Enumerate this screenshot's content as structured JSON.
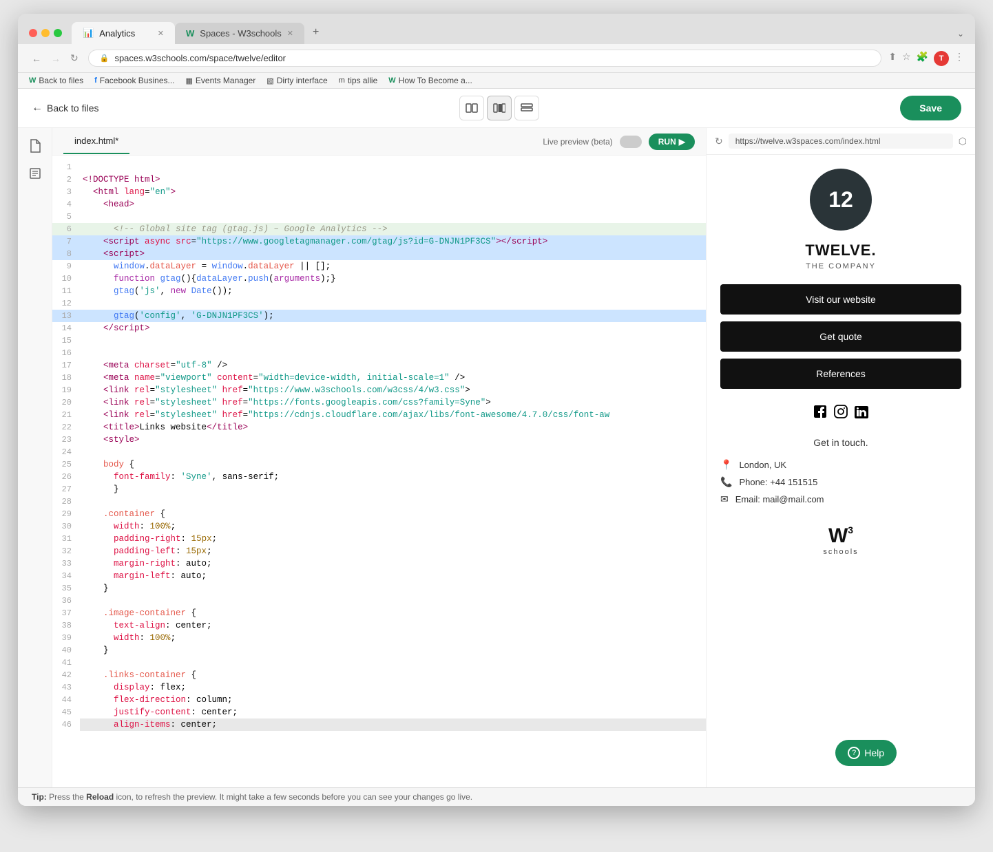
{
  "browser": {
    "tabs": [
      {
        "id": "analytics",
        "label": "Analytics",
        "icon": "📊",
        "active": true
      },
      {
        "id": "w3schools",
        "label": "Spaces - W3schools",
        "icon": "W",
        "active": false
      }
    ],
    "tab_new": "+",
    "tab_arrow": "⌄"
  },
  "address_bar": {
    "url": "spaces.w3schools.com/space/twelve/editor",
    "back": "←",
    "forward": "→",
    "refresh": "↻"
  },
  "bookmarks": [
    {
      "id": "w3-back",
      "label": "Back to files",
      "icon": "W"
    },
    {
      "id": "facebook",
      "label": "Facebook Busines...",
      "icon": "f"
    },
    {
      "id": "events",
      "label": "Events Manager",
      "icon": "□"
    },
    {
      "id": "dirty",
      "label": "Dirty interface",
      "icon": "□"
    },
    {
      "id": "tips",
      "label": "tips allie",
      "icon": "m"
    },
    {
      "id": "howto",
      "label": "How To Become a...",
      "icon": "W"
    }
  ],
  "toolbar": {
    "back_label": "Back to files",
    "save_label": "Save",
    "layout_icons": [
      "▭",
      "⊡",
      "▤"
    ]
  },
  "code_panel": {
    "file_tab": "index.html*",
    "live_preview_label": "Live preview (beta)",
    "run_label": "RUN"
  },
  "preview": {
    "url": "https://twelve.w3spaces.com/index.html",
    "site": {
      "logo_number": "12",
      "title": "TWELVE.",
      "subtitle": "THE COMPANY",
      "buttons": [
        "Visit our website",
        "Get quote",
        "References"
      ],
      "social_icons": [
        "f",
        "◉",
        "in"
      ],
      "get_touch": "Get in touch.",
      "contact": [
        {
          "icon": "📍",
          "text": "London, UK"
        },
        {
          "icon": "📞",
          "text": "Phone: +44 151515"
        },
        {
          "icon": "✉",
          "text": "Email: mail@mail.com"
        }
      ]
    }
  },
  "tip_bar": {
    "tip_prefix": "Tip:",
    "tip_text": " Press the ",
    "reload_word": "Reload",
    "tip_suffix": " icon, to refresh the preview. It might take a few seconds before you can see your changes go live."
  },
  "help": {
    "label": "Help",
    "icon": "?"
  },
  "code_lines": [
    {
      "num": 1,
      "content": ""
    },
    {
      "num": 2,
      "html": "<span class='c-comment'>&lt;!DOCTYPE html&gt;</span>",
      "raw": "<!DOCTYPE html>"
    },
    {
      "num": 3,
      "html": "  <span class='c-tag'>&lt;html</span> <span class='c-attr'>lang</span>=<span class='c-val'>\"en\"</span><span class='c-tag'>&gt;</span>"
    },
    {
      "num": 4,
      "html": "    <span class='c-tag'>&lt;head&gt;</span>"
    },
    {
      "num": 5,
      "content": ""
    },
    {
      "num": 6,
      "html": "      <span class='c-comment'>&lt;!-- Global site tag (gtag.js) – Google Analytics --&gt;</span>",
      "highlighted": true
    },
    {
      "num": 7,
      "html": "    <span class='c-tag'>&lt;script</span> <span class='c-attr'>async</span> <span class='c-attr'>src</span>=<span class='c-val'>\"https://www.googletagmanager.com/gtag/js?id=G-DNJN1PF3CS\"</span><span class='c-tag'>&gt;&lt;/script&gt;</span>",
      "selected": true
    },
    {
      "num": 8,
      "html": "    <span class='c-tag'>&lt;script&gt;</span>",
      "selected": true
    },
    {
      "num": 9,
      "html": "      <span class='c-fn'>window</span>.<span class='c-prop'>dataLayer</span> = <span class='c-fn'>window</span>.<span class='c-prop'>dataLayer</span> || [];"
    },
    {
      "num": 10,
      "html": "      <span class='c-kw'>function</span> <span class='c-fn'>gtag</span>(){<span class='c-fn'>dataLayer</span>.<span class='c-fn'>push</span>(<span class='c-kw'>arguments</span>);}"
    },
    {
      "num": 11,
      "html": "      <span class='c-fn'>gtag</span>(<span class='c-str'>'js'</span>, <span class='c-kw'>new</span> <span class='c-fn'>Date</span>());"
    },
    {
      "num": 12,
      "content": ""
    },
    {
      "num": 13,
      "html": "      <span class='c-fn'>gtag</span>(<span class='c-str'>'config'</span>, <span class='c-str'>'G-DNJN1PF3CS'</span>);",
      "selected": true
    },
    {
      "num": 14,
      "html": "    <span class='c-tag'>&lt;/script&gt;</span>"
    },
    {
      "num": 15,
      "content": ""
    },
    {
      "num": 16,
      "content": ""
    },
    {
      "num": 17,
      "html": "    <span class='c-tag'>&lt;meta</span> <span class='c-attr'>charset</span>=<span class='c-val'>\"utf-8\"</span> /&gt;"
    },
    {
      "num": 18,
      "html": "    <span class='c-tag'>&lt;meta</span> <span class='c-attr'>name</span>=<span class='c-val'>\"viewport\"</span> <span class='c-attr'>content</span>=<span class='c-val'>\"width=device-width, initial-scale=1\"</span> /&gt;"
    },
    {
      "num": 19,
      "html": "    <span class='c-tag'>&lt;link</span> <span class='c-attr'>rel</span>=<span class='c-val'>\"stylesheet\"</span> <span class='c-attr'>href</span>=<span class='c-val'>\"https://www.w3schools.com/w3css/4/w3.css\"</span>&gt;"
    },
    {
      "num": 20,
      "html": "    <span class='c-tag'>&lt;link</span> <span class='c-attr'>rel</span>=<span class='c-val'>\"stylesheet\"</span> <span class='c-attr'>href</span>=<span class='c-val'>\"https://fonts.googleapis.com/css?family=Syne\"</span>&gt;"
    },
    {
      "num": 21,
      "html": "    <span class='c-tag'>&lt;link</span> <span class='c-attr'>rel</span>=<span class='c-val'>\"stylesheet\"</span> <span class='c-attr'>href</span>=<span class='c-val'>\"https://cdnjs.cloudflare.com/ajax/libs/font-awesome/4.7.0/css/font-aw</span>"
    },
    {
      "num": 22,
      "html": "    <span class='c-tag'>&lt;title&gt;</span>Links website<span class='c-tag'>&lt;/title&gt;</span>"
    },
    {
      "num": 23,
      "html": "    <span class='c-tag'>&lt;style&gt;</span>"
    },
    {
      "num": 24,
      "content": ""
    },
    {
      "num": 25,
      "html": "    <span class='c-prop'>body</span> {"
    },
    {
      "num": 26,
      "html": "      <span class='c-attr'>font-family</span>: <span class='c-str'>'Syne'</span>, sans-serif;"
    },
    {
      "num": 27,
      "html": "      }"
    },
    {
      "num": 28,
      "content": ""
    },
    {
      "num": 29,
      "html": "    <span class='c-prop'>.container</span> {"
    },
    {
      "num": 30,
      "html": "      <span class='c-attr'>width</span>: <span class='c-num'>100%</span>;"
    },
    {
      "num": 31,
      "html": "      <span class='c-attr'>padding-right</span>: <span class='c-num'>15px</span>;"
    },
    {
      "num": 32,
      "html": "      <span class='c-attr'>padding-left</span>: <span class='c-num'>15px</span>;"
    },
    {
      "num": 33,
      "html": "      <span class='c-attr'>margin-right</span>: auto;"
    },
    {
      "num": 34,
      "html": "      <span class='c-attr'>margin-left</span>: auto;"
    },
    {
      "num": 35,
      "html": "    }"
    },
    {
      "num": 36,
      "content": ""
    },
    {
      "num": 37,
      "html": "    <span class='c-prop'>.image-container</span> {"
    },
    {
      "num": 38,
      "html": "      <span class='c-attr'>text-align</span>: center;"
    },
    {
      "num": 39,
      "html": "      <span class='c-attr'>width</span>: <span class='c-num'>100%</span>;"
    },
    {
      "num": 40,
      "html": "    }"
    },
    {
      "num": 41,
      "content": ""
    },
    {
      "num": 42,
      "html": "    <span class='c-prop'>.links-container</span> {"
    },
    {
      "num": 43,
      "html": "      <span class='c-attr'>display</span>: flex;"
    },
    {
      "num": 44,
      "html": "      <span class='c-attr'>flex-direction</span>: column;"
    },
    {
      "num": 45,
      "html": "      <span class='c-attr'>justify-content</span>: center;"
    },
    {
      "num": 46,
      "html": "      <span class='c-attr'>align-items</span>: center;"
    }
  ]
}
